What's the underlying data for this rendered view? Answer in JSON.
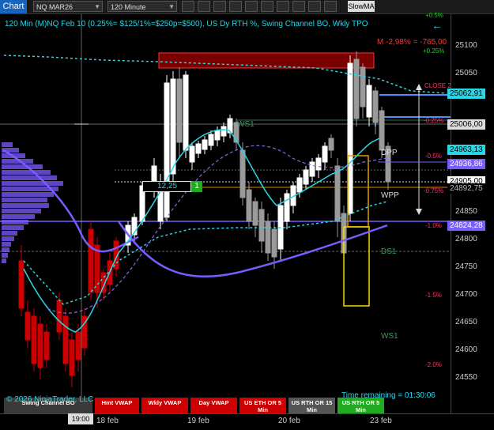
{
  "toolbar": {
    "chart_tab": "Chart",
    "instrument": "NQ MAR26",
    "interval": "120 Minute",
    "indicator_button": "SlowMA"
  },
  "chart": {
    "title": "120 Min (M)NQ Feb 10 (0.25%= $125/1%=$250p=$500), US Dy RTH %, Swing Channel BO, Wkly TPO",
    "pnl": "M -2,98% = -765,00",
    "pct_top_a": "+0.5%",
    "pct_top_b": "+0.25%",
    "close_label": "CLOSE 2",
    "pct_labels": [
      "-0.25%",
      "-0.5%",
      "-0.75%",
      "-1.0%",
      "-1.5%",
      "-2.0%"
    ],
    "level_labels": {
      "ws1_upper": "WS1",
      "dpp": "DPP",
      "wpp": "WPP",
      "ds1": "DS1",
      "ws1_lower": "WS1"
    },
    "crosshair_value": "12,25",
    "crosshair_badge": "1"
  },
  "chart_data": {
    "type": "candlestick",
    "y_ticks": [
      25100,
      25050,
      25000,
      24950,
      24900,
      24850,
      24800,
      24750,
      24700,
      24650,
      24600,
      24550
    ],
    "ylim": [
      24510,
      25150
    ],
    "x_ticks": [
      "18 feb",
      "19 feb",
      "20 feb",
      "23 feb"
    ],
    "price_markers": [
      {
        "label": "25062,91",
        "value": 25062.91
      },
      {
        "label": "25006,00",
        "value": 25006.0
      },
      {
        "label": "24963,13",
        "value": 24963.13
      },
      {
        "label": "24936,86",
        "value": 24936.86
      },
      {
        "label": "24905,00",
        "value": 24905.0
      },
      {
        "label": "24892,75",
        "value": 24892.75
      },
      {
        "label": "24824,28",
        "value": 24824.28
      }
    ]
  },
  "legend_buttons": [
    {
      "label": "Swing Channel BO",
      "color": "#3a3a3a"
    },
    {
      "label": "Hmt VWAP",
      "color": "#cc0000"
    },
    {
      "label": "Wkly VWAP",
      "color": "#cc0000"
    },
    {
      "label": "Day VWAP",
      "color": "#cc0000"
    },
    {
      "label": "US ETH OR 5 Min",
      "color": "#cc0000"
    },
    {
      "label": "US RTH OR 15 Min",
      "color": "#555555"
    },
    {
      "label": "US RTH OR 5 Min",
      "color": "#22aa22"
    }
  ],
  "footer": {
    "copyright": "© 2026 NinjaTrader, LLC",
    "time_remaining": "Time remaining = 01:30:06",
    "cursor_time": "19:00"
  },
  "colors": {
    "accent": "#29d6e6",
    "up": "#ffffff",
    "down": "#cc0000",
    "channel": "#7b5cff"
  }
}
